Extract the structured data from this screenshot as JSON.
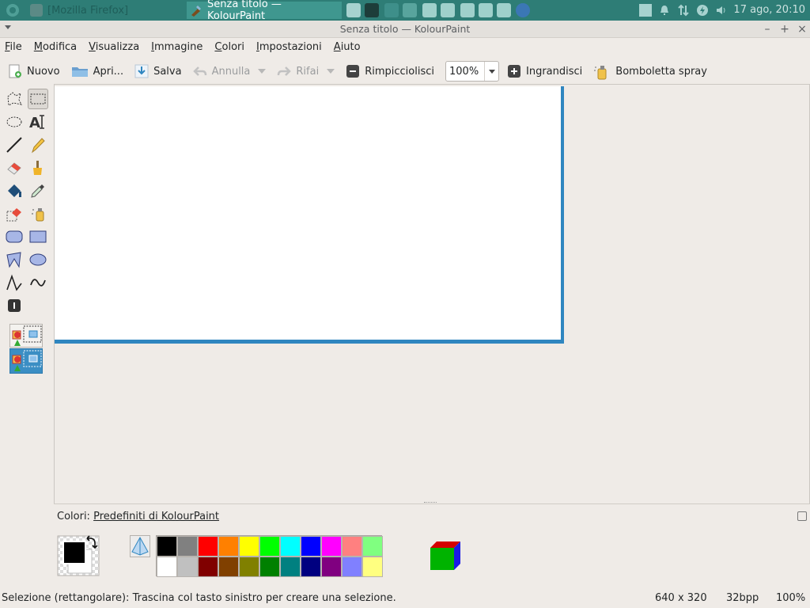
{
  "panel": {
    "tasks": [
      {
        "label": "[Mozilla Firefox]"
      },
      {
        "label": "Senza titolo  — KolourPaint"
      }
    ],
    "clock": "17 ago, 20:10"
  },
  "window": {
    "title": "Senza titolo  — KolourPaint"
  },
  "menu": [
    "File",
    "Modifica",
    "Visualizza",
    "Immagine",
    "Colori",
    "Impostazioni",
    "Aiuto"
  ],
  "toolbar": {
    "new_label": "Nuovo",
    "open_label": "Apri...",
    "save_label": "Salva",
    "undo_label": "Annulla",
    "redo_label": "Rifai",
    "zoom_out_label": "Rimpicciolisci",
    "zoom_value": "100%",
    "zoom_in_label": "Ingrandisci",
    "spray_label": "Bomboletta spray"
  },
  "colors": {
    "label_prefix": "Colori: ",
    "label_scheme": "Predefiniti di KolourPaint",
    "foreground": "#000000",
    "background": "#ffffff",
    "palette_top": [
      "#000000",
      "#808080",
      "#ff0000",
      "#ff8000",
      "#ffff00",
      "#00ff00",
      "#00ffff",
      "#0000ff",
      "#ff00ff",
      "#ff8080",
      "#80ff80"
    ],
    "palette_bottom": [
      "#ffffff",
      "#c0c0c0",
      "#800000",
      "#804000",
      "#808000",
      "#008000",
      "#008080",
      "#000080",
      "#800080",
      "#8080ff",
      "#ffff80"
    ]
  },
  "status": {
    "message": "Selezione (rettangolare): Trascina col tasto sinistro per creare una selezione.",
    "size": "640 x 320",
    "depth": "32bpp",
    "zoom": "100%"
  }
}
